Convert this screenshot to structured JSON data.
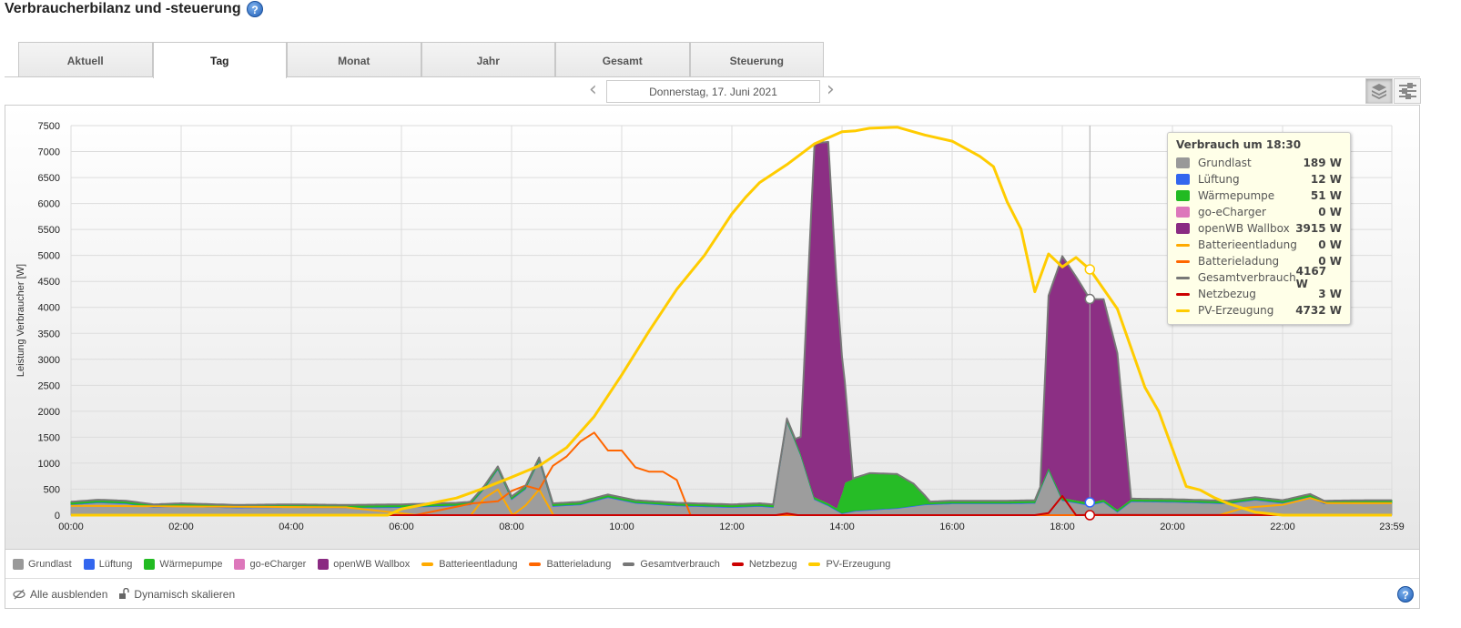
{
  "header": {
    "title": "Verbraucherbilanz und -steuerung",
    "help": "?"
  },
  "tabs": [
    {
      "label": "Aktuell",
      "active": false
    },
    {
      "label": "Tag",
      "active": true
    },
    {
      "label": "Monat",
      "active": false
    },
    {
      "label": "Jahr",
      "active": false
    },
    {
      "label": "Gesamt",
      "active": false
    },
    {
      "label": "Steuerung",
      "active": false
    }
  ],
  "date_nav": {
    "prev": "‹",
    "date": "Donnerstag, 17. Juni 2021",
    "next": "›"
  },
  "tooltip": {
    "title": "Verbrauch um 18:30",
    "rows": [
      {
        "name": "Grundlast",
        "value": "189 W"
      },
      {
        "name": "Lüftung",
        "value": "12 W"
      },
      {
        "name": "Wärmepumpe",
        "value": "51 W"
      },
      {
        "name": "go-eCharger",
        "value": "0 W"
      },
      {
        "name": "openWB Wallbox",
        "value": "3915 W"
      },
      {
        "name": "Batterieentladung",
        "value": "0 W"
      },
      {
        "name": "Batterieladung",
        "value": "0 W"
      },
      {
        "name": "Gesamtverbrauch",
        "value": "4167 W"
      },
      {
        "name": "Netzbezug",
        "value": "3 W"
      },
      {
        "name": "PV-Erzeugung",
        "value": "4732 W"
      }
    ]
  },
  "bottom": {
    "hide_all": "Alle ausblenden",
    "dynamic_scale": "Dynamisch skalieren",
    "help": "?"
  },
  "chart_data": {
    "type": "area",
    "title": "",
    "ylabel": "Leistung Verbraucher [W]",
    "xlabel": "",
    "x_unit": "hour",
    "ylim": [
      0,
      7500
    ],
    "yticks": [
      0,
      500,
      1000,
      1500,
      2000,
      2500,
      3000,
      3500,
      4000,
      4500,
      5000,
      5500,
      6000,
      6500,
      7000,
      7500
    ],
    "xticks": [
      {
        "t": 0,
        "label": "00:00"
      },
      {
        "t": 2,
        "label": "02:00"
      },
      {
        "t": 4,
        "label": "04:00"
      },
      {
        "t": 6,
        "label": "06:00"
      },
      {
        "t": 8,
        "label": "08:00"
      },
      {
        "t": 10,
        "label": "10:00"
      },
      {
        "t": 12,
        "label": "12:00"
      },
      {
        "t": 14,
        "label": "14:00"
      },
      {
        "t": 16,
        "label": "16:00"
      },
      {
        "t": 18,
        "label": "18:00"
      },
      {
        "t": 20,
        "label": "20:00"
      },
      {
        "t": 22,
        "label": "22:00"
      },
      {
        "t": 23.983,
        "label": "23:59"
      }
    ],
    "grid": true,
    "legend_position": "bottom",
    "crosshair_t": 18.5,
    "stacked": [
      {
        "name": "Grundlast",
        "color": "#999999",
        "points": [
          [
            0,
            200
          ],
          [
            0.5,
            240
          ],
          [
            1,
            220
          ],
          [
            1.5,
            150
          ],
          [
            2,
            170
          ],
          [
            3,
            140
          ],
          [
            4,
            150
          ],
          [
            5,
            140
          ],
          [
            6,
            150
          ],
          [
            7,
            180
          ],
          [
            7.25,
            200
          ],
          [
            7.5,
            500
          ],
          [
            7.75,
            880
          ],
          [
            8,
            300
          ],
          [
            8.25,
            500
          ],
          [
            8.5,
            1050
          ],
          [
            8.75,
            170
          ],
          [
            9.25,
            200
          ],
          [
            9.75,
            340
          ],
          [
            10.25,
            230
          ],
          [
            11,
            180
          ],
          [
            12,
            150
          ],
          [
            12.5,
            170
          ],
          [
            12.75,
            150
          ],
          [
            13,
            1800
          ],
          [
            13.25,
            1150
          ],
          [
            13.5,
            300
          ],
          [
            13.75,
            180
          ],
          [
            14,
            30
          ],
          [
            14.25,
            80
          ],
          [
            15,
            130
          ],
          [
            15.5,
            200
          ],
          [
            16,
            220
          ],
          [
            17,
            220
          ],
          [
            17.5,
            230
          ],
          [
            17.75,
            870
          ],
          [
            18,
            280
          ],
          [
            18.5,
            189
          ],
          [
            18.75,
            250
          ],
          [
            19,
            60
          ],
          [
            19.25,
            260
          ],
          [
            20,
            250
          ],
          [
            21,
            220
          ],
          [
            21.5,
            290
          ],
          [
            22,
            230
          ],
          [
            22.5,
            350
          ],
          [
            22.75,
            220
          ],
          [
            23.5,
            230
          ],
          [
            23.983,
            230
          ]
        ]
      },
      {
        "name": "Lüftung",
        "color": "#3366ff",
        "points": [
          [
            0,
            12
          ],
          [
            23.983,
            12
          ]
        ]
      },
      {
        "name": "Wärmepumpe",
        "color": "#22bb22",
        "points": [
          [
            0,
            45
          ],
          [
            13.9,
            45
          ],
          [
            14.05,
            580
          ],
          [
            14.5,
            700
          ],
          [
            15,
            650
          ],
          [
            15.3,
            420
          ],
          [
            15.6,
            45
          ],
          [
            23.983,
            45
          ]
        ]
      },
      {
        "name": "go-eCharger",
        "color": "#e07cc0",
        "points": [
          [
            0,
            0
          ],
          [
            23.983,
            0
          ]
        ]
      },
      {
        "name": "openWB Wallbox",
        "color": "#8a2b82",
        "points": [
          [
            0,
            0
          ],
          [
            13.15,
            0
          ],
          [
            13.25,
            300
          ],
          [
            13.5,
            6800
          ],
          [
            13.75,
            6950
          ],
          [
            14,
            2600
          ],
          [
            14.2,
            0
          ],
          [
            17.6,
            0
          ],
          [
            17.75,
            3300
          ],
          [
            18,
            4650
          ],
          [
            18.25,
            4300
          ],
          [
            18.5,
            3915
          ],
          [
            18.75,
            3850
          ],
          [
            19,
            3000
          ],
          [
            19.25,
            0
          ],
          [
            23.983,
            0
          ]
        ]
      }
    ],
    "lines": [
      {
        "name": "Batterieentladung",
        "color": "#ffaa00",
        "points": [
          [
            0,
            180
          ],
          [
            5,
            150
          ],
          [
            6.3,
            0
          ],
          [
            7.26,
            0
          ],
          [
            7.5,
            324
          ],
          [
            7.75,
            494
          ],
          [
            8.02,
            0
          ],
          [
            8.26,
            193
          ],
          [
            8.5,
            494
          ],
          [
            8.76,
            0
          ],
          [
            20.85,
            0
          ],
          [
            21.3,
            140
          ],
          [
            22,
            200
          ],
          [
            22.5,
            330
          ],
          [
            22.8,
            230
          ],
          [
            23.983,
            230
          ]
        ]
      },
      {
        "name": "Batterieladung",
        "color": "#ff6600",
        "points": [
          [
            0,
            0
          ],
          [
            6.25,
            0
          ],
          [
            7.3,
            227
          ],
          [
            7.75,
            267
          ],
          [
            8,
            466
          ],
          [
            8.25,
            568
          ],
          [
            8.5,
            494
          ],
          [
            8.75,
            949
          ],
          [
            9,
            1130
          ],
          [
            9.25,
            1420
          ],
          [
            9.5,
            1590
          ],
          [
            9.75,
            1244
          ],
          [
            10,
            1244
          ],
          [
            10.25,
            920
          ],
          [
            10.5,
            835
          ],
          [
            10.75,
            835
          ],
          [
            11,
            676
          ],
          [
            11.25,
            0
          ],
          [
            23.983,
            0
          ]
        ]
      },
      {
        "name": "Gesamtverbrauch",
        "color": "#777777",
        "derived": "sum_of_stacked"
      },
      {
        "name": "Netzbezug",
        "color": "#cc0000",
        "points": [
          [
            0,
            0
          ],
          [
            12.8,
            0
          ],
          [
            13,
            30
          ],
          [
            13.2,
            0
          ],
          [
            17.5,
            0
          ],
          [
            17.75,
            40
          ],
          [
            18,
            370
          ],
          [
            18.25,
            0
          ],
          [
            18.5,
            3
          ],
          [
            23.983,
            0
          ]
        ]
      },
      {
        "name": "PV-Erzeugung",
        "color": "#ffcc00",
        "points": [
          [
            0,
            0
          ],
          [
            5.75,
            0
          ],
          [
            6,
            120
          ],
          [
            6.5,
            220
          ],
          [
            7,
            330
          ],
          [
            7.5,
            520
          ],
          [
            8,
            730
          ],
          [
            8.5,
            950
          ],
          [
            9,
            1300
          ],
          [
            9.5,
            1900
          ],
          [
            10,
            2700
          ],
          [
            10.5,
            3550
          ],
          [
            11,
            4350
          ],
          [
            11.5,
            5000
          ],
          [
            12,
            5800
          ],
          [
            12.25,
            6120
          ],
          [
            12.5,
            6400
          ],
          [
            13,
            6750
          ],
          [
            13.5,
            7150
          ],
          [
            14,
            7380
          ],
          [
            14.25,
            7400
          ],
          [
            14.5,
            7450
          ],
          [
            15,
            7470
          ],
          [
            15.5,
            7320
          ],
          [
            16,
            7200
          ],
          [
            16.5,
            6910
          ],
          [
            16.75,
            6710
          ],
          [
            17,
            6030
          ],
          [
            17.25,
            5510
          ],
          [
            17.5,
            4300
          ],
          [
            17.75,
            5030
          ],
          [
            18,
            4780
          ],
          [
            18.25,
            4960
          ],
          [
            18.5,
            4732
          ],
          [
            19,
            3970
          ],
          [
            19.5,
            2460
          ],
          [
            19.75,
            2000
          ],
          [
            20.25,
            553
          ],
          [
            20.5,
            485
          ],
          [
            20.75,
            342
          ],
          [
            21,
            228
          ],
          [
            21.5,
            57
          ],
          [
            22,
            0
          ],
          [
            23.983,
            0
          ]
        ]
      }
    ],
    "legend": [
      {
        "name": "Grundlast",
        "kind": "area",
        "color": "#999999"
      },
      {
        "name": "Lüftung",
        "kind": "area",
        "color": "#3366ee"
      },
      {
        "name": "Wärmepumpe",
        "kind": "area",
        "color": "#22bb22"
      },
      {
        "name": "go-eCharger",
        "kind": "area",
        "color": "#dd77bb"
      },
      {
        "name": "openWB Wallbox",
        "kind": "area",
        "color": "#8a2b82"
      },
      {
        "name": "Batterieentladung",
        "kind": "line",
        "color": "#ffaa00"
      },
      {
        "name": "Batterieladung",
        "kind": "line",
        "color": "#ff6600"
      },
      {
        "name": "Gesamtverbrauch",
        "kind": "line",
        "color": "#777777"
      },
      {
        "name": "Netzbezug",
        "kind": "line",
        "color": "#cc0000"
      },
      {
        "name": "PV-Erzeugung",
        "kind": "line",
        "color": "#ffcc00"
      }
    ]
  }
}
